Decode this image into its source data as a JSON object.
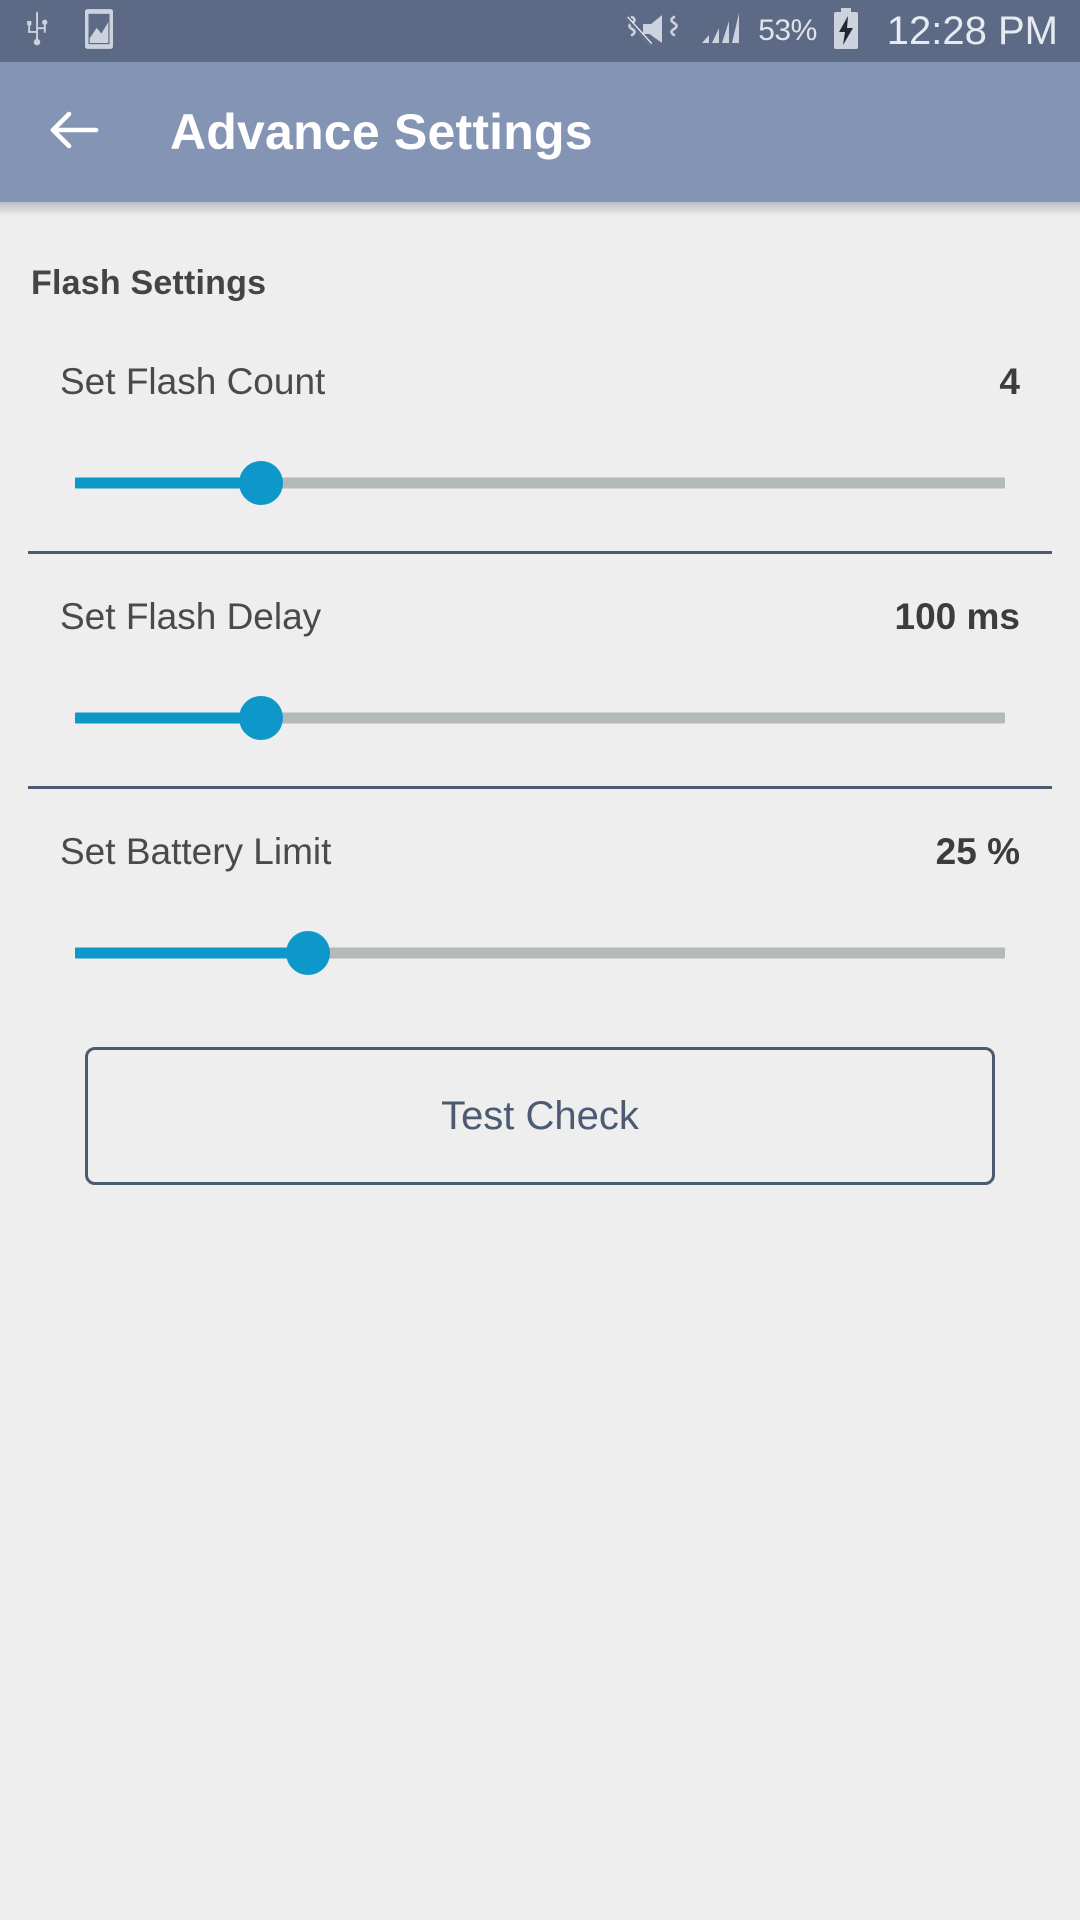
{
  "status_bar": {
    "left_icons": [
      {
        "name": "usb-icon",
        "label": "USB connected"
      },
      {
        "name": "screenshot-icon",
        "label": "Screenshot captured"
      }
    ],
    "right_icons": [
      {
        "name": "mute-vibrate-icon",
        "label": "Sound off / vibrate"
      },
      {
        "name": "signal-bars-icon",
        "label": "Signal strength 4 bars"
      },
      {
        "name": "battery-charging-icon",
        "label": "Battery charging"
      }
    ],
    "battery_percent": "53%",
    "time": "12:28 PM",
    "background_color": "#5c6a85",
    "text_color": "#e6eaf1"
  },
  "app_bar": {
    "back_icon": "arrow-left-icon",
    "title": "Advance Settings",
    "background_color": "#8494b4",
    "title_color": "#ffffff"
  },
  "content": {
    "section_title": "Flash Settings",
    "accent_color": "#0d98c9",
    "divider_color": "#4c5a72",
    "background_color": "#eeeeee",
    "settings": [
      {
        "label": "Set Flash Count",
        "value": "4",
        "slider_percent": 20,
        "divider_after": true
      },
      {
        "label": "Set Flash Delay",
        "value": "100 ms",
        "slider_percent": 20,
        "divider_after": true
      },
      {
        "label": "Set Battery Limit",
        "value": "25 %",
        "slider_percent": 25,
        "divider_after": false
      }
    ],
    "test_button": {
      "label": "Test Check",
      "border_color": "#4c5a72",
      "text_color": "#4c5a72"
    }
  }
}
